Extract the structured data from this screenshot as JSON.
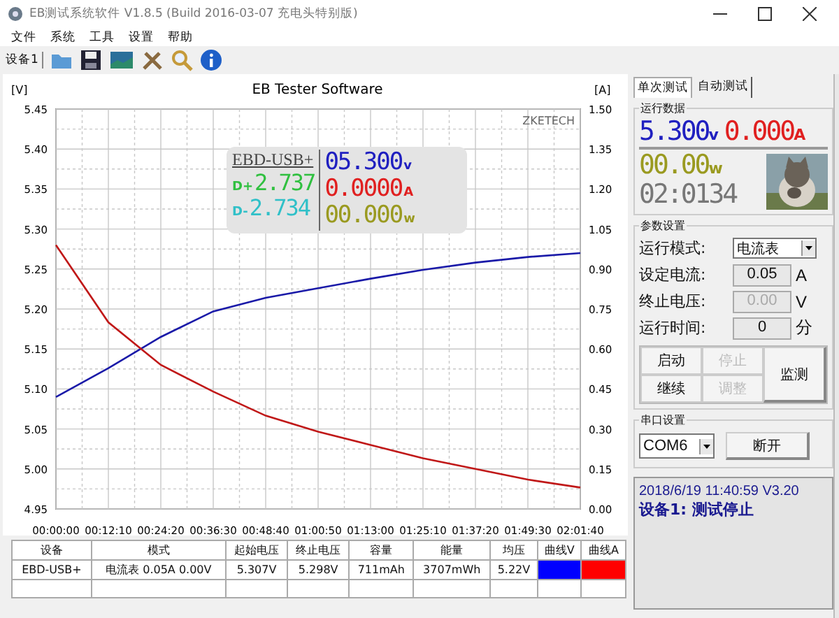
{
  "window": {
    "title": "EB测试系统软件 V1.8.5 (Build 2016-03-07 充电头特别版)"
  },
  "menu": [
    "文件",
    "系统",
    "工具",
    "设置",
    "帮助"
  ],
  "toolbar": {
    "device_label": "设备1"
  },
  "chart": {
    "brand": "ZKETECH",
    "overlay": {
      "device": "EBD-USB+",
      "dp_label": "D+",
      "dp": "2.737",
      "dm_label": "D-",
      "dm": "2.734",
      "voltage": "05.300",
      "voltage_unit": "v",
      "current": "0.0000",
      "current_unit": "A",
      "power": "00.000",
      "power_unit": "w"
    },
    "chart_data": {
      "type": "line",
      "title": "EB Tester Software",
      "categories": [
        "00:00:00",
        "00:12:10",
        "00:24:20",
        "00:36:30",
        "00:48:40",
        "01:00:50",
        "01:13:00",
        "01:25:10",
        "01:37:20",
        "01:49:30",
        "02:01:40"
      ],
      "ylabel": "[V]",
      "y2label": "[A]",
      "grid": true,
      "series": [
        {
          "color": "#1a1aa8",
          "values": [
            5.09,
            5.126,
            5.165,
            5.197,
            5.214,
            5.226,
            5.238,
            5.249,
            5.258,
            5.265,
            5.27
          ]
        },
        {
          "color": "#c01818",
          "axis": "y2",
          "values": [
            0.99,
            0.7,
            0.54,
            0.44,
            0.35,
            0.29,
            0.24,
            0.19,
            0.15,
            0.11,
            0.08
          ]
        }
      ],
      "ylim": [
        4.95,
        5.45
      ],
      "yticks": [
        {
          "value": 4.95,
          "label": "4.95"
        },
        {
          "value": 5.0,
          "label": "5.00"
        },
        {
          "value": 5.05,
          "label": "5.05"
        },
        {
          "value": 5.1,
          "label": "5.10"
        },
        {
          "value": 5.15,
          "label": "5.15"
        },
        {
          "value": 5.2,
          "label": "5.20"
        },
        {
          "value": 5.25,
          "label": "5.25"
        },
        {
          "value": 5.3,
          "label": "5.30"
        },
        {
          "value": 5.35,
          "label": "5.35"
        },
        {
          "value": 5.4,
          "label": "5.40"
        },
        {
          "value": 5.45,
          "label": "5.45"
        }
      ],
      "y2lim": [
        0,
        1.5
      ],
      "y2ticks": [
        {
          "value": 0,
          "label": "0.00"
        },
        {
          "value": 0.15,
          "label": "0.15"
        },
        {
          "value": 0.3,
          "label": "0.30"
        },
        {
          "value": 0.45,
          "label": "0.45"
        },
        {
          "value": 0.6,
          "label": "0.60"
        },
        {
          "value": 0.75,
          "label": "0.75"
        },
        {
          "value": 0.9,
          "label": "0.90"
        },
        {
          "value": 1.05,
          "label": "1.05"
        },
        {
          "value": 1.2,
          "label": "1.20"
        },
        {
          "value": 1.35,
          "label": "1.35"
        },
        {
          "value": 1.5,
          "label": "1.50"
        }
      ]
    }
  },
  "summary_table": {
    "columns": [
      "设备",
      "模式",
      "起始电压",
      "终止电压",
      "容量",
      "能量",
      "均压",
      "曲线V",
      "曲线A"
    ],
    "rows": [
      {
        "cells": [
          "EBD-USB+",
          "电流表 0.05A 0.00V",
          "5.307V",
          "5.298V",
          "711mAh",
          "3707mWh",
          "5.22V"
        ],
        "curves": [
          {
            "color": "#0000ff"
          },
          {
            "color": "#ff0000"
          }
        ]
      }
    ]
  },
  "tabs": [
    {
      "label": "单次测试",
      "selected": true
    },
    {
      "label": "自动测试",
      "selected": false
    }
  ],
  "readings": {
    "group": "运行数据",
    "voltage": "5.300",
    "voltage_unit": "v",
    "current": "0.000",
    "current_unit": "A",
    "power": "00.00",
    "power_unit": "w",
    "time": "02:0134"
  },
  "params": {
    "group": "参数设置",
    "fields": [
      {
        "kind": "select",
        "label": "运行模式:",
        "value": "电流表"
      },
      {
        "kind": "input",
        "label": "设定电流:",
        "value": "0.05",
        "unit": "A",
        "disabled": false
      },
      {
        "kind": "input",
        "label": "终止电压:",
        "value": "0.00",
        "unit": "V",
        "disabled": true
      },
      {
        "kind": "input",
        "label": "运行时间:",
        "value": "0",
        "unit": "分",
        "disabled": false
      }
    ],
    "buttons": [
      {
        "label": "启动",
        "disabled": false
      },
      {
        "label": "停止",
        "disabled": true
      },
      {
        "label": "继续",
        "disabled": false
      },
      {
        "label": "调整",
        "disabled": true
      }
    ],
    "monitor_button": "监测"
  },
  "serial": {
    "group": "串口设置",
    "port": "COM6",
    "button": "断开"
  },
  "status": {
    "line1": "2018/6/19 11:40:59  V3.20",
    "line2": "设备1: 测试停止"
  }
}
